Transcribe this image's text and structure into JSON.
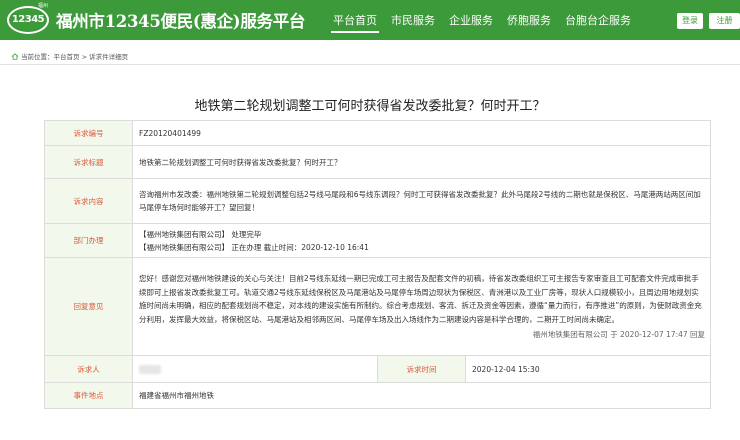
{
  "header": {
    "logo_text": "12345",
    "logo_sub": "福州",
    "site_title": "福州市12345便民(惠企)服务平台",
    "nav": [
      "平台首页",
      "市民服务",
      "企业服务",
      "侨胞服务",
      "台胞台企服务"
    ],
    "login_label": "登录",
    "register_label": "注册"
  },
  "breadcrumb": "当前位置：平台首页 > 诉求件详细页",
  "page_title": "地铁第二轮规划调整工可何时获得省发改委批复？何时开工？",
  "labels": {
    "id": "诉求编号",
    "title": "诉求标题",
    "content": "诉求内容",
    "dept": "部门办理",
    "reply": "回复意见",
    "person": "诉求人",
    "time": "诉求时间",
    "location": "事件地点"
  },
  "values": {
    "id": "FZ20120401499",
    "title": "地铁第二轮规划调整工可何时获得省发改委批复？何时开工？",
    "content": "咨询福州市发改委：福州地铁第二轮规划调整包括2号线马尾段和6号线东调段？何时工可获得省发改委批复？此外马尾段2号线的二期也就是保税区、马尾港两站两区间加马尾停车场何时能够开工？望回复！",
    "dept_line1": "【福州地铁集团有限公司】 处理完毕",
    "dept_line2": "【福州地铁集团有限公司】 正在办理 截止时间：2020-12-10 16:41",
    "reply": "您好！感谢您对福州地铁建设的关心与关注！目前2号线东延线一期已完成工可主报告及配套文件的初稿，待省发改委组织工可主报告专家审查且工可配套文件完成审批手续即可上报省发改委批复工可。轨道交通2号线东延线保税区及马尾港站及马尾停车场周边现状为保税区、青洲港以及工业厂房等，现状人口规模较小，且周边用地规划实施时间尚未明确，相应的配套规划尚不稳定，对本线的建设实施有所制约。综合考虑规划、客流、拆迁及资金等因素，遵循“量力而行，有序推进”的原则，为使财政资金充分利用，发挥最大效益，将保税区站、马尾港站及相邻两区间、马尾停车场及出入场线作为二期建设内容是科学合理的，二期开工时间尚未确定。",
    "reply_meta": "福州地铁集团有限公司 于 2020-12-07 17:47 回复",
    "person": "",
    "time": "2020-12-04 15:30",
    "location": "福建省福州市福州地铁"
  }
}
